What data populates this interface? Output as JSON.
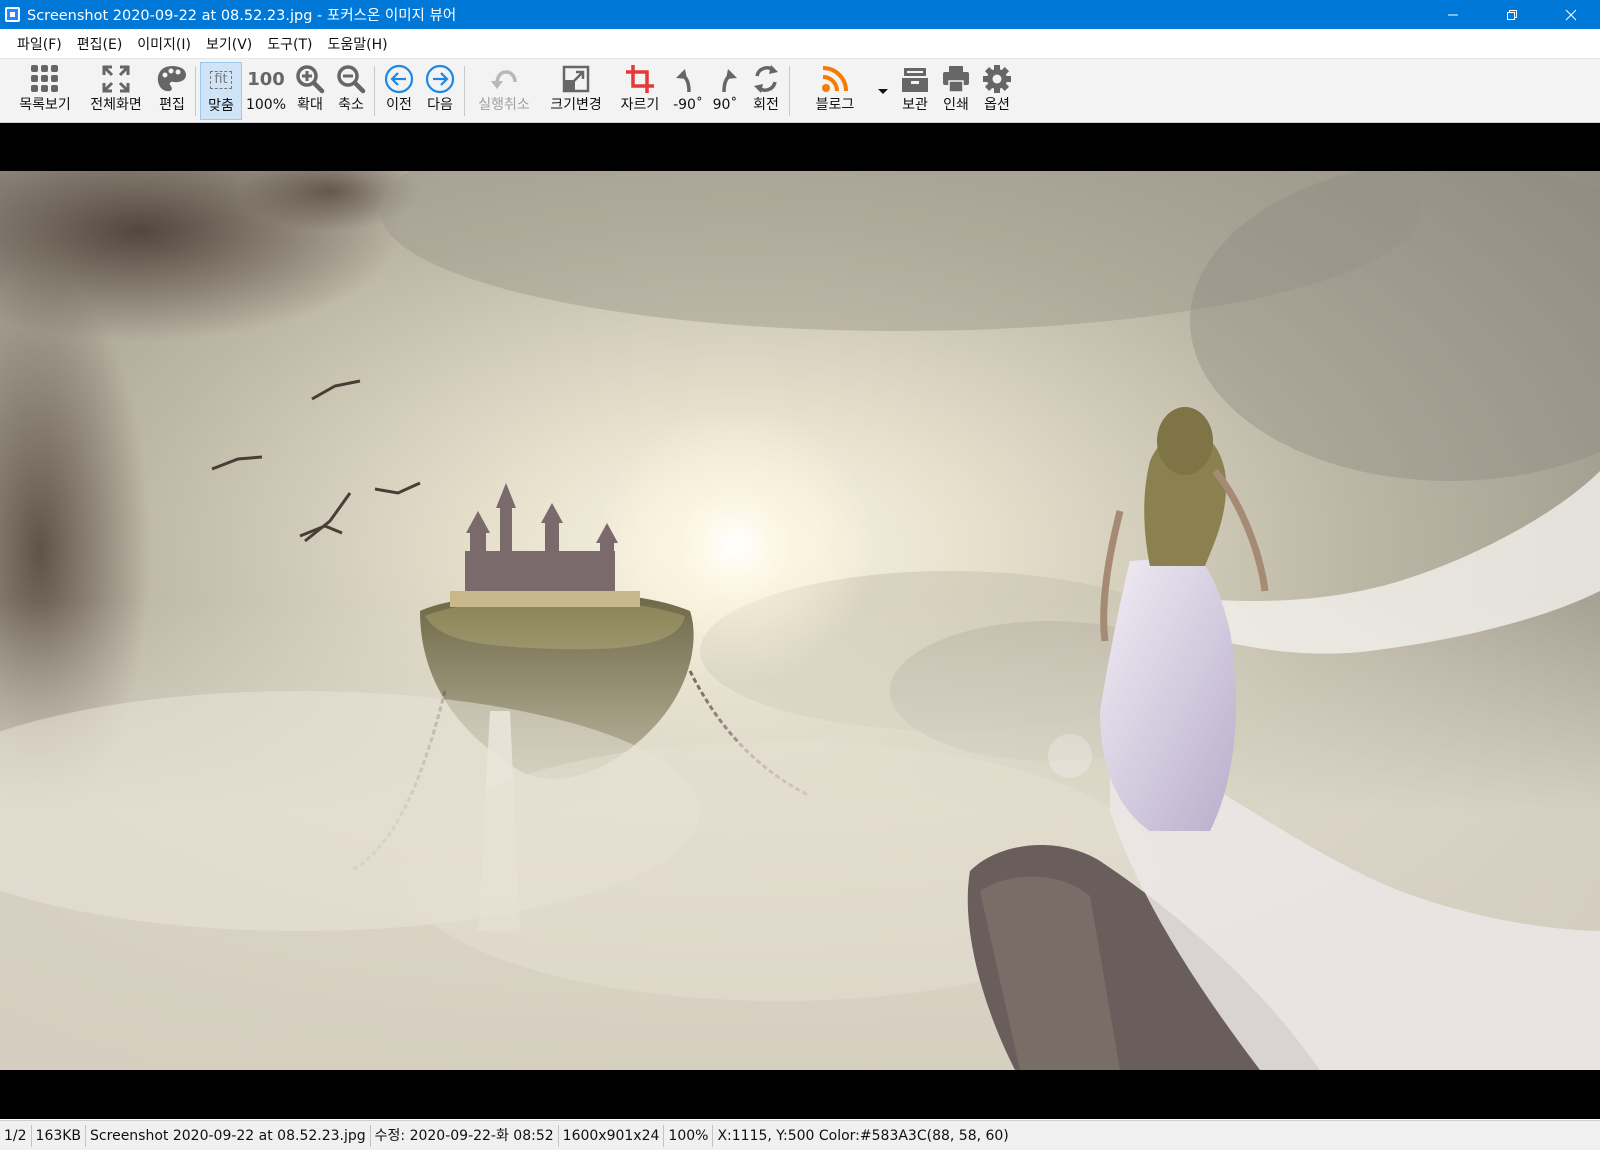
{
  "window": {
    "title": "Screenshot 2020-09-22 at 08.52.23.jpg - 포커스온 이미지 뷰어"
  },
  "menu": {
    "items": [
      "파일(F)",
      "편집(E)",
      "이미지(I)",
      "보기(V)",
      "도구(T)",
      "도움말(H)"
    ]
  },
  "toolbar": {
    "list_view": "목록보기",
    "fullscreen": "전체화면",
    "edit": "편집",
    "fit": "맞춤",
    "fit_icon_text": "fit",
    "actual_size": "100%",
    "actual_size_icon_text": "100",
    "zoom_in": "확대",
    "zoom_out": "축소",
    "previous": "이전",
    "next": "다음",
    "undo": "실행취소",
    "resize": "크기변경",
    "crop": "자르기",
    "rotate_left": "-90˚",
    "rotate_right": "90˚",
    "rotate": "회전",
    "blog": "블로그",
    "save": "보관",
    "print": "인쇄",
    "options": "옵션"
  },
  "status": {
    "page": "1/2",
    "file_size": "163KB",
    "file_name": "Screenshot 2020-09-22 at 08.52.23.jpg",
    "modified": "수정: 2020-09-22-화 08:52",
    "dimensions": "1600x901x24",
    "zoom": "100%",
    "pixel_info": "X:1115, Y:500 Color:#583A3C(88, 58, 60)"
  },
  "colors": {
    "titlebar": "#0078d7",
    "nav_blue": "#1e88e5",
    "crop_red": "#e53935",
    "rss_orange": "#f57c00"
  }
}
